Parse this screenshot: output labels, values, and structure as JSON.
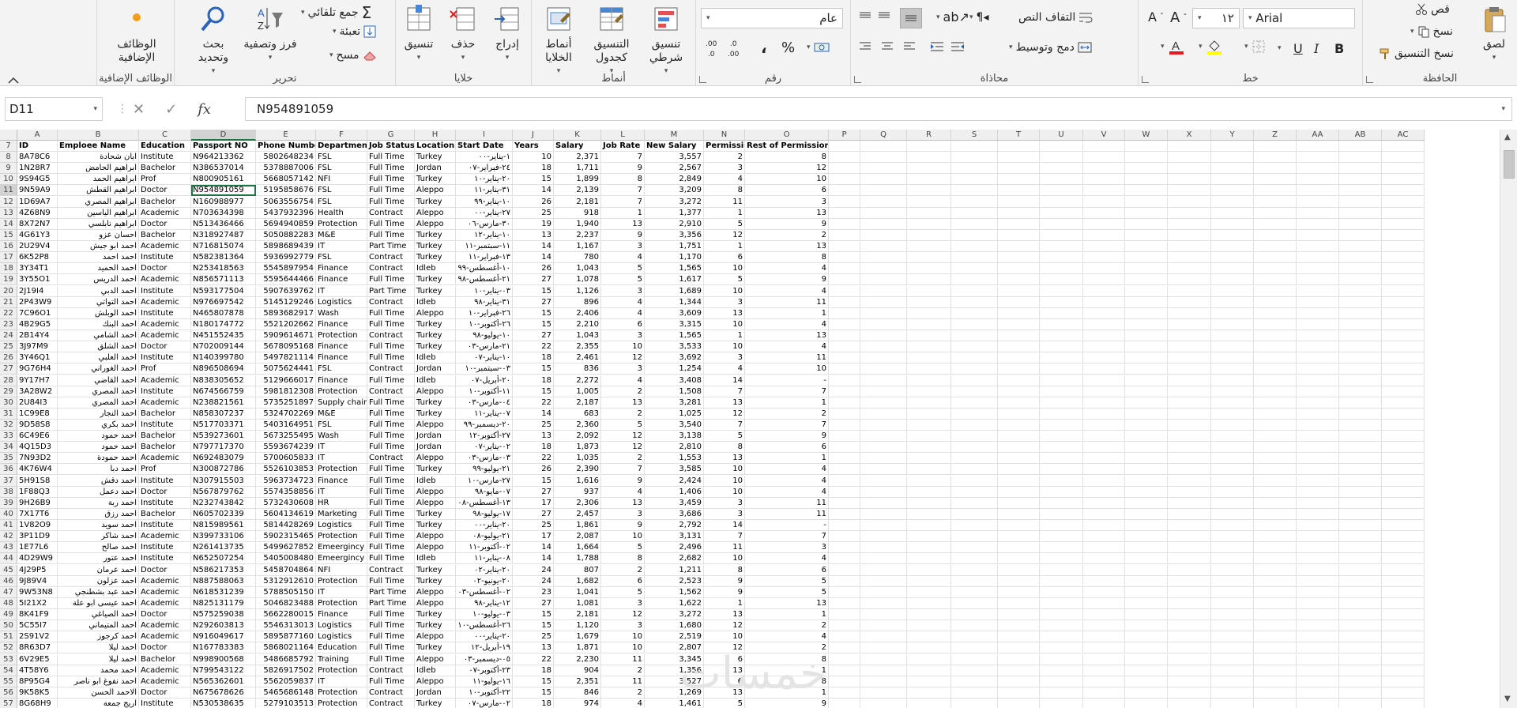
{
  "ribbon": {
    "groups": {
      "clipboard": "الحافظة",
      "font": "خط",
      "alignment": "محاذاة",
      "number": "رقم",
      "styles": "أنماط",
      "cells": "خلايا",
      "editing": "تحرير",
      "addins": "الوظائف الإضافية"
    },
    "clipboard": {
      "paste": "لصق",
      "cut": "قص",
      "copy": "نسخ",
      "format_painter": "نسخ التنسيق"
    },
    "font": {
      "name": "Arial",
      "size": "١٢",
      "bold": "B",
      "italic": "I",
      "underline": "U"
    },
    "alignment": {
      "wrap": "التفاف النص",
      "merge": "دمج وتوسيط"
    },
    "number": {
      "format": "عام",
      "percent": "%",
      "comma": "،",
      "inc_dec": ".00 ←.0",
      "dec_dec": ".0 →.00"
    },
    "styles": {
      "conditional": "تنسيق شرطي",
      "table": "التنسيق كجدول",
      "cell_styles": "أنماط الخلايا"
    },
    "cells": {
      "insert": "إدراج",
      "delete": "حذف",
      "format": "تنسيق"
    },
    "editing": {
      "autosum": "جمع تلقائي",
      "fill": "تعبئة",
      "clear": "مسح",
      "sort": "فرز وتصفية",
      "find": "بحث وتحديد"
    },
    "addins": {
      "label": "الوظائف الإضافية"
    }
  },
  "formula_bar": {
    "name_box": "D11",
    "cancel": "✕",
    "enter": "✓",
    "fx": "fx",
    "value": "N954891059"
  },
  "colors": {
    "excel_green": "#217346",
    "header_bg": "#efefef"
  },
  "columns": [
    "A",
    "B",
    "C",
    "D",
    "E",
    "F",
    "G",
    "H",
    "I",
    "J",
    "K",
    "L",
    "M",
    "N",
    "O",
    "P",
    "Q",
    "R",
    "S",
    "T",
    "U",
    "V",
    "W",
    "X",
    "Y",
    "Z",
    "AA",
    "AB",
    "AC"
  ],
  "header_row": {
    "row": "7",
    "cells": [
      "ID",
      "Emploee Name",
      "Education",
      "Passport NO",
      "Phone Number",
      "Department",
      "Job Status",
      "Location",
      "Start Date",
      "Years",
      "Salary",
      "Job Rate",
      "New Salary",
      "Permissions",
      "Rest of Permissions"
    ]
  },
  "rows": [
    [
      "8",
      "8A78C6",
      "ابان شحادة",
      "Institute",
      "N964213362",
      "5802648234",
      "FSL",
      "Full Time",
      "Turkey",
      "١-يناير-٠٠",
      "10",
      "2,371",
      "7",
      "3,557",
      "2",
      "8"
    ],
    [
      "9",
      "1N28R7",
      "ابراهيم الحامض",
      "Bachelor",
      "N386537014",
      "5378887006",
      "FSL",
      "Full Time",
      "Jordan",
      "٢٤-فبراير-٠٧",
      "18",
      "1,711",
      "9",
      "2,567",
      "3",
      "12"
    ],
    [
      "10",
      "9S94G5",
      "ابراهيم الحمد",
      "Prof",
      "N800905161",
      "5668057142",
      "NFI",
      "Full Time",
      "Turkey",
      "٢٠-يناير-١٠",
      "15",
      "1,899",
      "8",
      "2,849",
      "4",
      "10"
    ],
    [
      "11",
      "9N59A9",
      "ابراهيم القطش",
      "Doctor",
      "N954891059",
      "5195858676",
      "FSL",
      "Full Time",
      "Aleppo",
      "٣١-يناير-١١",
      "14",
      "2,139",
      "7",
      "3,209",
      "8",
      "6"
    ],
    [
      "12",
      "1D69A7",
      "ابراهيم المصري",
      "Bachelor",
      "N160988977",
      "5063556754",
      "FSL",
      "Full Time",
      "Turkey",
      "١٠-يناير-٩٩",
      "26",
      "2,181",
      "7",
      "3,272",
      "11",
      "3"
    ],
    [
      "13",
      "4Z68N9",
      "ابراهيم الياسين",
      "Academic",
      "N703634398",
      "5437932396",
      "Health",
      "Contract",
      "Aleppo",
      "٢٧-يناير-٠٠",
      "25",
      "918",
      "1",
      "1,377",
      "1",
      "13"
    ],
    [
      "14",
      "8X72N7",
      "ابراهيم نابلسي",
      "Doctor",
      "N513436466",
      "5694940859",
      "Protection",
      "Full Time",
      "Aleppo",
      "٣٠-مارس-٠٦",
      "19",
      "1,940",
      "13",
      "2,910",
      "5",
      "9"
    ],
    [
      "15",
      "4G61Y3",
      "احسان عزو",
      "Bachelor",
      "N318927487",
      "5050882283",
      "M&E",
      "Full Time",
      "Turkey",
      "١٠-يناير-١٢",
      "13",
      "2,237",
      "9",
      "3,356",
      "12",
      "2"
    ],
    [
      "16",
      "2U29V4",
      "احمد ابو جيش",
      "Academic",
      "N716815074",
      "5898689439",
      "IT",
      "Part Time",
      "Turkey",
      "١١-سبتمبر-١١",
      "14",
      "1,167",
      "3",
      "1,751",
      "1",
      "13"
    ],
    [
      "17",
      "6K52P8",
      "احمد احمد",
      "Institute",
      "N582381364",
      "5936992779",
      "FSL",
      "Contract",
      "Turkey",
      "١٣-فبراير-١١",
      "14",
      "780",
      "4",
      "1,170",
      "6",
      "8"
    ],
    [
      "18",
      "3Y34T1",
      "احمد الحميد",
      "Doctor",
      "N253418563",
      "5545897954",
      "Finance",
      "Contract",
      "Idleb",
      "١٠-أغسطس-٩٩",
      "26",
      "1,043",
      "5",
      "1,565",
      "10",
      "4"
    ],
    [
      "19",
      "3Y55O1",
      "احمد الدريس",
      "Academic",
      "N856571113",
      "5595644466",
      "Finance",
      "Full Time",
      "Turkey",
      "٢١-أغسطس-٩٨",
      "27",
      "1,078",
      "5",
      "1,617",
      "5",
      "9"
    ],
    [
      "20",
      "2J19I4",
      "احمد الدبي",
      "Institute",
      "N593177504",
      "5907639762",
      "IT",
      "Part Time",
      "Turkey",
      "٠٣-يناير-١٠",
      "15",
      "1,126",
      "3",
      "1,689",
      "10",
      "4"
    ],
    [
      "21",
      "2P43W9",
      "احمد التواتي",
      "Academic",
      "N976697542",
      "5145129246",
      "Logistics",
      "Contract",
      "Idleb",
      "٣١-يناير-٩٨",
      "27",
      "896",
      "4",
      "1,344",
      "3",
      "11"
    ],
    [
      "22",
      "7C96O1",
      "احمد الوبلش",
      "Institute",
      "N465807878",
      "5893682917",
      "Wash",
      "Full Time",
      "Aleppo",
      "٢٦-فبراير-١٠",
      "15",
      "2,406",
      "4",
      "3,609",
      "13",
      "1"
    ],
    [
      "23",
      "4B29G5",
      "احمد البنك",
      "Academic",
      "N180174772",
      "5521202662",
      "Finance",
      "Full Time",
      "Turkey",
      "٢٦-أكتوبر-١٠",
      "15",
      "2,210",
      "6",
      "3,315",
      "10",
      "4"
    ],
    [
      "24",
      "2B14Y4",
      "احمد الشامي",
      "Academic",
      "N451552435",
      "5909614671",
      "Protection",
      "Contract",
      "Turkey",
      "١٠-يوليو-٩٨",
      "27",
      "1,043",
      "3",
      "1,565",
      "1",
      "13"
    ],
    [
      "25",
      "3J97M9",
      "احمد الشلق",
      "Doctor",
      "N702009144",
      "5678095168",
      "Finance",
      "Full Time",
      "Turkey",
      "٢١-مارس-٠٣",
      "22",
      "2,355",
      "10",
      "3,533",
      "10",
      "4"
    ],
    [
      "26",
      "3Y46Q1",
      "احمد العلبي",
      "Institute",
      "N140399780",
      "5497821114",
      "Finance",
      "Full Time",
      "Idleb",
      "١٠-يناير-٠٧",
      "18",
      "2,461",
      "12",
      "3,692",
      "3",
      "11"
    ],
    [
      "27",
      "9G76H4",
      "احمد الغوراني",
      "Prof",
      "N896508694",
      "5075624441",
      "FSL",
      "Contract",
      "Jordan",
      "٠٣-سبتمبر-١٠",
      "15",
      "836",
      "3",
      "1,254",
      "4",
      "10"
    ],
    [
      "28",
      "9Y17H7",
      "احمد القاضي",
      "Academic",
      "N838305652",
      "5129666017",
      "Finance",
      "Full Time",
      "Idleb",
      "٢٠-أبريل-٠٧",
      "18",
      "2,272",
      "4",
      "3,408",
      "14",
      "-"
    ],
    [
      "29",
      "3A28W2",
      "احمد المصري",
      "Institute",
      "N674566759",
      "5981812308",
      "Protection",
      "Contract",
      "Aleppo",
      "١١-أكتوبر-١٠",
      "15",
      "1,005",
      "2",
      "1,508",
      "7",
      "7"
    ],
    [
      "30",
      "2U84I3",
      "احمد المصري",
      "Academic",
      "N238821561",
      "5735251897",
      "Supply chain",
      "Full Time",
      "Turkey",
      "٠٤-مارس-٠٣",
      "22",
      "2,187",
      "13",
      "3,281",
      "13",
      "1"
    ],
    [
      "31",
      "1C99E8",
      "احمد النجار",
      "Bachelor",
      "N858307237",
      "5324702269",
      "M&E",
      "Full Time",
      "Turkey",
      "٠٧-يناير-١١",
      "14",
      "683",
      "2",
      "1,025",
      "12",
      "2"
    ],
    [
      "32",
      "9D58S8",
      "احمد بكري",
      "Institute",
      "N517703371",
      "5403164951",
      "FSL",
      "Full Time",
      "Aleppo",
      "٢٠-ديسمبر-٩٩",
      "25",
      "2,360",
      "5",
      "3,540",
      "7",
      "7"
    ],
    [
      "33",
      "6C49E6",
      "احمد حمود",
      "Bachelor",
      "N539273601",
      "5673255495",
      "Wash",
      "Full Time",
      "Jordan",
      "٢٧-أكتوبر-١٢",
      "13",
      "2,092",
      "12",
      "3,138",
      "5",
      "9"
    ],
    [
      "34",
      "4Q15D3",
      "احمد حمود",
      "Bachelor",
      "N797717370",
      "5593674239",
      "IT",
      "Full Time",
      "Jordan",
      "٠٢-يناير-٠٧",
      "18",
      "1,873",
      "12",
      "2,810",
      "8",
      "6"
    ],
    [
      "35",
      "7N93D2",
      "احمد حمودة",
      "Academic",
      "N692483079",
      "5700605833",
      "IT",
      "Contract",
      "Aleppo",
      "٠٣-مارس-٠٣",
      "22",
      "1,035",
      "2",
      "1,553",
      "13",
      "1"
    ],
    [
      "36",
      "4K76W4",
      "احمد دبا",
      "Prof",
      "N300872786",
      "5526103853",
      "Protection",
      "Full Time",
      "Turkey",
      "٢١-يوليو-٩٩",
      "26",
      "2,390",
      "7",
      "3,585",
      "10",
      "4"
    ],
    [
      "37",
      "5H91S8",
      "احمد دقش",
      "Institute",
      "N307915503",
      "5963734723",
      "Finance",
      "Full Time",
      "Idleb",
      "٢٧-مارس-١٠",
      "15",
      "1,616",
      "9",
      "2,424",
      "10",
      "4"
    ],
    [
      "38",
      "1F88Q3",
      "احمد دعمل",
      "Doctor",
      "N567879762",
      "5574358856",
      "IT",
      "Full Time",
      "Aleppo",
      "٠٧-مايو-٩٨",
      "27",
      "937",
      "4",
      "1,406",
      "10",
      "4"
    ],
    [
      "39",
      "9H26B9",
      "احمد ربة",
      "Institute",
      "N232743842",
      "5732430608",
      "HR",
      "Full Time",
      "Aleppo",
      "١٣-أغسطس-٠٨",
      "17",
      "2,306",
      "13",
      "3,459",
      "3",
      "11"
    ],
    [
      "40",
      "7X17T6",
      "احمد رزق",
      "Bachelor",
      "N605702339",
      "5604134619",
      "Marketing",
      "Full Time",
      "Turkey",
      "١٧-يوليو-٩٨",
      "27",
      "2,457",
      "3",
      "3,686",
      "3",
      "11"
    ],
    [
      "41",
      "1V82O9",
      "احمد سويد",
      "Institute",
      "N815989561",
      "5814428269",
      "Logistics",
      "Full Time",
      "Turkey",
      "٢٠-يناير-٠٠",
      "25",
      "1,861",
      "9",
      "2,792",
      "14",
      "-"
    ],
    [
      "42",
      "3P11D9",
      "احمد شاكر",
      "Academic",
      "N399733106",
      "5902315465",
      "Protection",
      "Full Time",
      "Aleppo",
      "٢١-يوليو-٠٨",
      "17",
      "2,087",
      "10",
      "3,131",
      "7",
      "7"
    ],
    [
      "43",
      "1E77L6",
      "احمد صالح",
      "Institute",
      "N261413735",
      "5499627852",
      "Emeergincy",
      "Full Time",
      "Aleppo",
      "٠٢-أكتوبر-١١",
      "14",
      "1,664",
      "5",
      "2,496",
      "11",
      "3"
    ],
    [
      "44",
      "4D29W9",
      "احمد عتور",
      "Institute",
      "N652507254",
      "5405008480",
      "Emeergincy",
      "Full Time",
      "Idleb",
      "٠٨-يناير-١١",
      "14",
      "1,788",
      "8",
      "2,682",
      "10",
      "4"
    ],
    [
      "45",
      "4J29P5",
      "احمد عرمان",
      "Doctor",
      "N586217353",
      "5458704864",
      "NFI",
      "Contract",
      "Turkey",
      "٢٠-يناير-٠٢",
      "24",
      "807",
      "2",
      "1,211",
      "8",
      "6"
    ],
    [
      "46",
      "9J89V4",
      "احمد عزلون",
      "Academic",
      "N887588063",
      "5312912610",
      "Protection",
      "Full Time",
      "Turkey",
      "٢٠-يونيو-٠٢",
      "24",
      "1,682",
      "6",
      "2,523",
      "9",
      "5"
    ],
    [
      "47",
      "9W53N8",
      "احمد عبد بشطنجي",
      "Academic",
      "N618531239",
      "5788505150",
      "IT",
      "Part Time",
      "Aleppo",
      "٠٢-أغسطس-٠٣",
      "23",
      "1,041",
      "5",
      "1,562",
      "9",
      "5"
    ],
    [
      "48",
      "5I21X2",
      "احمد عيسى ابو علة",
      "Academic",
      "N825131179",
      "5046823488",
      "Protection",
      "Part Time",
      "Aleppo",
      "١٢-يناير-٩٨",
      "27",
      "1,081",
      "3",
      "1,622",
      "1",
      "13"
    ],
    [
      "49",
      "8K41F9",
      "احمد الصياغي",
      "Doctor",
      "N575259038",
      "5662280015",
      "Finance",
      "Full Time",
      "Turkey",
      "٠٣-يوليو-١٠",
      "15",
      "2,181",
      "12",
      "3,272",
      "13",
      "1"
    ],
    [
      "50",
      "5C55I7",
      "احمد المتيماني",
      "Academic",
      "N292603813",
      "5546313013",
      "Logistics",
      "Full Time",
      "Turkey",
      "٢٦-أغسطس-١٠",
      "15",
      "1,120",
      "3",
      "1,680",
      "12",
      "2"
    ],
    [
      "51",
      "2S91V2",
      "احمد كرجوز",
      "Academic",
      "N916049617",
      "5895877160",
      "Logistics",
      "Full Time",
      "Aleppo",
      "٢٠-يناير-٠٠",
      "25",
      "1,679",
      "10",
      "2,519",
      "10",
      "4"
    ],
    [
      "52",
      "8R63D7",
      "احمد ليلا",
      "Doctor",
      "N167783383",
      "5868021164",
      "Education",
      "Full Time",
      "Turkey",
      "١٩-أبريل-١٢",
      "13",
      "1,871",
      "10",
      "2,807",
      "12",
      "2"
    ],
    [
      "53",
      "6V29E5",
      "احمد ليلا",
      "Bachelor",
      "N998900568",
      "5486685792",
      "Training",
      "Full Time",
      "Aleppo",
      "٠٥-ديسمبر-٠٣",
      "22",
      "2,230",
      "11",
      "3,345",
      "6",
      "8"
    ],
    [
      "54",
      "4T58Y6",
      "احمد محمد",
      "Academic",
      "N799543122",
      "5826917502",
      "Protection",
      "Contract",
      "Idleb",
      "٢٣-أكتوبر-٠٧",
      "18",
      "904",
      "2",
      "1,356",
      "13",
      "1"
    ],
    [
      "55",
      "8P95G4",
      "احمد نفوغ ابو ناصر",
      "Academic",
      "N565362601",
      "5562059837",
      "IT",
      "Full Time",
      "Aleppo",
      "١٦-يوليو-١١",
      "15",
      "2,351",
      "11",
      "3,527",
      "6",
      "8"
    ],
    [
      "56",
      "9K58K5",
      "الاحمد الحسن",
      "Doctor",
      "N675678626",
      "5465686148",
      "Protection",
      "Contract",
      "Jordan",
      "٢٢-أكتوبر-١٠",
      "15",
      "846",
      "2",
      "1,269",
      "13",
      "1"
    ],
    [
      "57",
      "8G68H9",
      "اريج جمعة",
      "Institute",
      "N530538635",
      "5279103513",
      "Protection",
      "Contract",
      "Turkey",
      "٠٢-مارس-٠٧",
      "18",
      "974",
      "4",
      "1,461",
      "5",
      "9"
    ]
  ],
  "watermark": "خمسات"
}
